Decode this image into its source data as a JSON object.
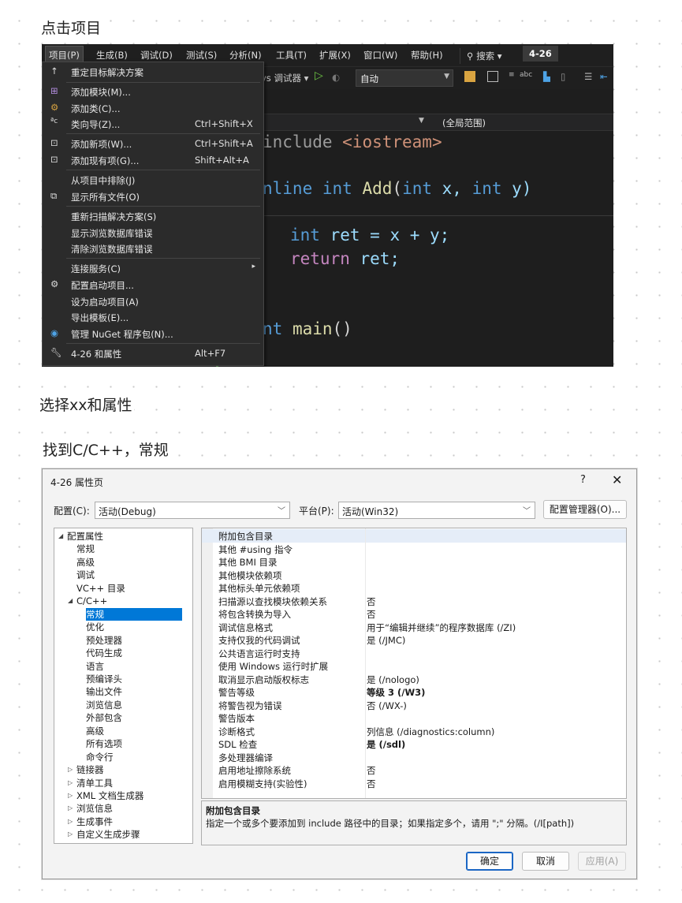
{
  "notes": [
    "点击项目",
    "选择xx和属性",
    "找到C/C++，常规"
  ],
  "vs": {
    "menubar": [
      "项目(P)",
      "生成(B)",
      "调试(D)",
      "测试(S)",
      "分析(N)",
      "工具(T)",
      "扩展(X)",
      "窗口(W)",
      "帮助(H)"
    ],
    "search": "搜索 ▾",
    "solution": "4-26",
    "toolbar": {
      "debugger": "vs 调试器 ▾",
      "config": "自动"
    },
    "navbar_scope": "(全局范围)",
    "code": {
      "l1_pp": "include",
      "l1_str": " <iostream>",
      "l2_kw": "nline",
      "l2_int": "int",
      "l2_fn": "Add",
      "l2_params": "(",
      "l2_int2": "int",
      "l2_x": " x, ",
      "l2_int3": "int",
      "l2_y": " y)",
      "l3_int": "int",
      "l3_rest": " ret = x + y;",
      "l4_ret": "return",
      "l4_rest": " ret;",
      "l5_kw": "nt",
      "l5_fn": " main",
      "l5_rest": "()"
    },
    "menu_items": [
      {
        "label": "重定目标解决方案",
        "shortcut": "",
        "icon": "retarget-icon"
      },
      {
        "label": "添加模块(M)...",
        "shortcut": "",
        "icon": "add-module-icon"
      },
      {
        "label": "添加类(C)...",
        "shortcut": "",
        "icon": "add-class-icon"
      },
      {
        "label": "类向导(Z)...",
        "shortcut": "Ctrl+Shift+X",
        "icon": "class-wizard-icon"
      },
      {
        "label": "添加新项(W)...",
        "shortcut": "Ctrl+Shift+A",
        "icon": "add-new-item-icon"
      },
      {
        "label": "添加现有项(G)...",
        "shortcut": "Shift+Alt+A",
        "icon": "add-existing-item-icon"
      },
      {
        "label": "从项目中排除(J)",
        "shortcut": "",
        "icon": ""
      },
      {
        "label": "显示所有文件(O)",
        "shortcut": "",
        "icon": "show-all-files-icon"
      },
      {
        "label": "重新扫描解决方案(S)",
        "shortcut": "",
        "icon": ""
      },
      {
        "label": "显示浏览数据库错误",
        "shortcut": "",
        "icon": ""
      },
      {
        "label": "清除浏览数据库错误",
        "shortcut": "",
        "icon": ""
      },
      {
        "label": "连接服务(C)",
        "shortcut": "",
        "icon": "",
        "submenu": "▸"
      },
      {
        "label": "配置启动项目...",
        "shortcut": "",
        "icon": "gear-icon"
      },
      {
        "label": "设为启动项目(A)",
        "shortcut": "",
        "icon": ""
      },
      {
        "label": "导出模板(E)...",
        "shortcut": "",
        "icon": ""
      },
      {
        "label": "管理 NuGet 程序包(N)...",
        "shortcut": "",
        "icon": "nuget-icon"
      },
      {
        "label": "4-26 和属性",
        "shortcut": "Alt+F7",
        "icon": "wrench-icon"
      }
    ]
  },
  "dialog": {
    "title": "4-26 属性页",
    "help": "?",
    "close": "✕",
    "config_label": "配置(C):",
    "config_value": "活动(Debug)",
    "platform_label": "平台(P):",
    "platform_value": "活动(Win32)",
    "config_manager": "配置管理器(O)...",
    "tree": [
      {
        "label": "配置属性",
        "level": 0,
        "exp": "◢"
      },
      {
        "label": "常规",
        "level": 1
      },
      {
        "label": "高级",
        "level": 1
      },
      {
        "label": "调试",
        "level": 1
      },
      {
        "label": "VC++ 目录",
        "level": 1
      },
      {
        "label": "C/C++",
        "level": 1,
        "exp": "◢"
      },
      {
        "label": "常规",
        "level": 2,
        "selected": true
      },
      {
        "label": "优化",
        "level": 2
      },
      {
        "label": "预处理器",
        "level": 2
      },
      {
        "label": "代码生成",
        "level": 2
      },
      {
        "label": "语言",
        "level": 2
      },
      {
        "label": "预编译头",
        "level": 2
      },
      {
        "label": "输出文件",
        "level": 2
      },
      {
        "label": "浏览信息",
        "level": 2
      },
      {
        "label": "外部包含",
        "level": 2
      },
      {
        "label": "高级",
        "level": 2
      },
      {
        "label": "所有选项",
        "level": 2
      },
      {
        "label": "命令行",
        "level": 2
      },
      {
        "label": "链接器",
        "level": 1,
        "exp": "▷"
      },
      {
        "label": "清单工具",
        "level": 1,
        "exp": "▷"
      },
      {
        "label": "XML 文档生成器",
        "level": 1,
        "exp": "▷"
      },
      {
        "label": "浏览信息",
        "level": 1,
        "exp": "▷"
      },
      {
        "label": "生成事件",
        "level": 1,
        "exp": "▷"
      },
      {
        "label": "自定义生成步骤",
        "level": 1,
        "exp": "▷"
      }
    ],
    "props": [
      {
        "k": "附加包含目录",
        "v": "",
        "hl": true
      },
      {
        "k": "其他 #using 指令",
        "v": ""
      },
      {
        "k": "其他 BMI 目录",
        "v": ""
      },
      {
        "k": "其他模块依赖项",
        "v": ""
      },
      {
        "k": "其他标头单元依赖项",
        "v": ""
      },
      {
        "k": "扫描源以查找模块依赖关系",
        "v": "否"
      },
      {
        "k": "将包含转换为导入",
        "v": "否"
      },
      {
        "k": "调试信息格式",
        "v": "用于“编辑并继续”的程序数据库 (/ZI)"
      },
      {
        "k": "支持仅我的代码调试",
        "v": "是 (/JMC)"
      },
      {
        "k": "公共语言运行时支持",
        "v": ""
      },
      {
        "k": "使用 Windows 运行时扩展",
        "v": ""
      },
      {
        "k": "取消显示启动版权标志",
        "v": "是 (/nologo)"
      },
      {
        "k": "警告等级",
        "v": "等级 3 (/W3)",
        "bold": true
      },
      {
        "k": "将警告视为错误",
        "v": "否 (/WX-)"
      },
      {
        "k": "警告版本",
        "v": ""
      },
      {
        "k": "诊断格式",
        "v": "列信息 (/diagnostics:column)"
      },
      {
        "k": "SDL 检查",
        "v": "是 (/sdl)",
        "bold": true
      },
      {
        "k": "多处理器编译",
        "v": ""
      },
      {
        "k": "启用地址擦除系统",
        "v": "否"
      },
      {
        "k": "启用模糊支持(实验性)",
        "v": "否"
      }
    ],
    "desc_title": "附加包含目录",
    "desc_text": "指定一个或多个要添加到 include 路径中的目录；如果指定多个，请用 \";\" 分隔。(/I[path])",
    "ok": "确定",
    "cancel": "取消",
    "apply": "应用(A)"
  }
}
